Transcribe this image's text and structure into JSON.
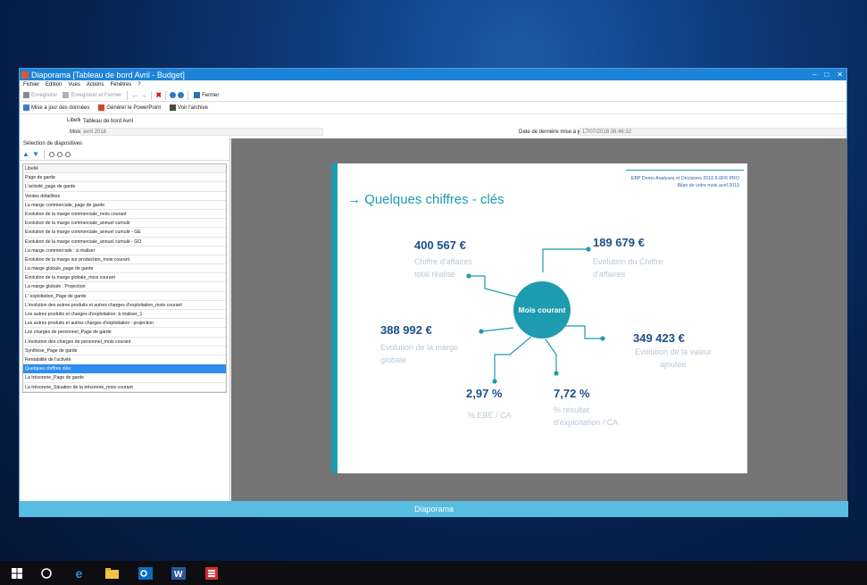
{
  "window": {
    "title": "Diaporama [Tableau de bord Avril - Budget]",
    "controls": {
      "minimize": "–",
      "maximize": "□",
      "close": "✕"
    }
  },
  "menu": [
    "Fichier",
    "Edition",
    "Vues",
    "Actions",
    "Fenêtres",
    "?"
  ],
  "toolbar1": {
    "save": "Enregistrer",
    "save_close": "Enregistrer et Fermer",
    "close": "Fermer"
  },
  "toolbar2": {
    "update": "Mise à jour des données",
    "ppt": "Générer le PowerPoint",
    "archive": "Voir l'archive"
  },
  "fields": {
    "libelle_label": "Libellé",
    "libelle_value": "Tableau de bord Avril",
    "mois_label": "Mois",
    "mois_value": "avril 2018",
    "date_label": "Date de dernière mise à jour",
    "date_value": "17/07/2018 08:46:32"
  },
  "left_panel": {
    "title": "Sélection de diapositives",
    "list_header": "Libellé",
    "selected_index": 21,
    "items": [
      "Page de garde",
      "L'activité_page de garde",
      "Ventes détaillées",
      "La marge commerciale_page de garde",
      "Evolution de la marge commerciale_mois courant",
      "Evolution de la marge commerciale_annuel cumulé",
      "Evolution de la marge commerciale_annuel cumulé - GE",
      "Evolution de la marge commerciale_annuel cumulé - GO",
      "La marge commerciale : à réaliser",
      "Evolution de la marge sur production_mois courant",
      "La marge globale_page de garde",
      "Evolution de la marge globale_mois courant",
      "La marge globale : Projection",
      "L' exploitation_Page de garde",
      "L'évolution des autres produits et  autres charges d'exploitation_mois courant",
      "Les autres produits et charges d'exploitation: à réaliser_1",
      "Les autres produits et autres charges d'exploitation : projection",
      "Les charges de personnel_Page de garde",
      "L'évolution des charges de personnel_mois courant",
      "Synthèse_Page de garde",
      "Rentabilité de l'activité",
      "Quelques chiffres clés",
      "La trésorerie_Page de garde",
      "La trésorerie_Situation de la trésorerie_mois courant"
    ]
  },
  "slide": {
    "org_line1": "EBP Demo Analyses et Decisions 2016 8.0FR PRO",
    "org_line2": "Bilan de votre mois avril 2019",
    "title": "→ Quelques chiffres - clés",
    "center": "Mois courant",
    "kpis": {
      "ca": {
        "value": "400 567 €",
        "label1": "Chiffre d'affaires",
        "label2": "total réalisé"
      },
      "evol_ca": {
        "value": "189 679 €",
        "label1": "Evolution du Chiffre",
        "label2": "d'affaires"
      },
      "marge": {
        "value": "388 992 €",
        "label1": "Evolution de la marge",
        "label2": "globale"
      },
      "va": {
        "value": "349 423 €",
        "label1": "Evolution de la valeur",
        "label2": "ajoutée"
      },
      "ebe": {
        "value": "2,97 %",
        "label1": "% EBE / CA"
      },
      "rex": {
        "value": "7,72 %",
        "label1": "% résultat",
        "label2": "d'exploitation / CA"
      }
    },
    "accent_color": "#1e9bae",
    "value_color": "#1c4f8c"
  },
  "statusbar": "Diaporama",
  "taskbar": [
    "windows-start-icon",
    "cortana-icon",
    "edge-icon",
    "file-explorer-icon",
    "outlook-icon",
    "word-icon",
    "ebp-app-icon"
  ]
}
